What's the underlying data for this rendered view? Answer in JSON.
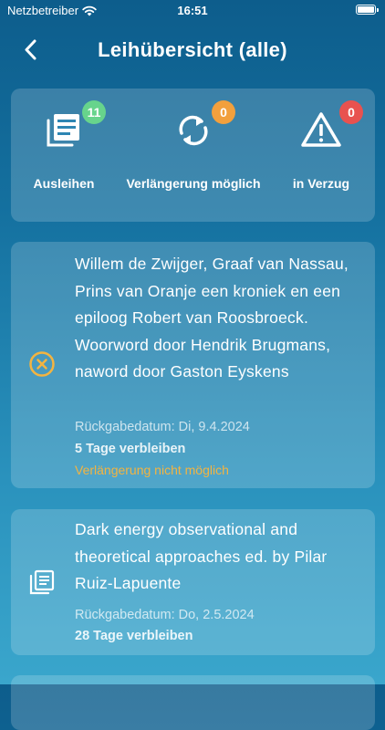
{
  "status_bar": {
    "carrier": "Netzbetreiber",
    "time": "16:51"
  },
  "header": {
    "title": "Leihübersicht (alle)",
    "back_icon": "chevron-left-icon"
  },
  "summary": [
    {
      "label": "Ausleihen",
      "count": "11",
      "badge_color": "#67d48c",
      "icon": "stacked-documents-icon"
    },
    {
      "label": "Verlängerung möglich",
      "count": "0",
      "badge_color": "#f2a03d",
      "icon": "sync-arrows-icon"
    },
    {
      "label": "in Verzug",
      "count": "0",
      "badge_color": "#e8524f",
      "icon": "warning-triangle-icon"
    }
  ],
  "loans": [
    {
      "title": "Willem de Zwijger, Graaf van Nassau, Prins van Oranje een kroniek en een epiloog Robert van Roosbroeck. Woorword door Hendrik Brugmans, naword door Gaston Eyskens",
      "due": "Rückgabedatum: Di, 9.4.2024",
      "remaining": "5 Tage verbleiben",
      "note": "Verlängerung nicht möglich",
      "icon": "cancel-circle-icon"
    },
    {
      "title": "Dark energy observational and theoretical approaches ed. by Pilar Ruiz-Lapuente",
      "due": "Rückgabedatum: Do, 2.5.2024",
      "remaining": "28 Tage verbleiben",
      "note": "",
      "icon": "document-stack-icon"
    }
  ]
}
